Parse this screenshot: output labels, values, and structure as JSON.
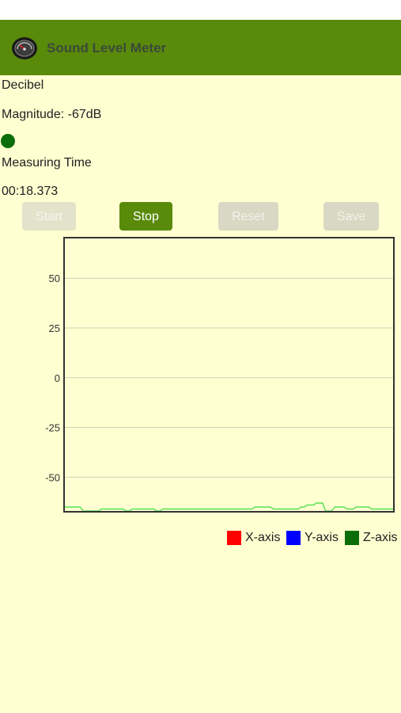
{
  "app": {
    "title": "Sound Level Meter",
    "icon": "speedometer-icon"
  },
  "labels": {
    "decibel": "Decibel",
    "magnitude": "Magnitude: -67dB",
    "measuring_time_label": "Measuring Time",
    "measuring_time_value": "00:18.373"
  },
  "buttons": {
    "start": "Start",
    "stop": "Stop",
    "reset": "Reset",
    "save": "Save"
  },
  "colors": {
    "header": "#5a8a0a",
    "background": "#ffffd1",
    "indicator": "#0b6e0b",
    "x_axis": "#ff0000",
    "y_axis": "#0000ff",
    "z_axis": "#0b6e0b",
    "z_line": "#55e055"
  },
  "chart_data": {
    "type": "line",
    "ylim": [
      -67,
      70
    ],
    "yticks": [
      50,
      25,
      0,
      -25,
      -50
    ],
    "ytick_labels": [
      "50",
      "25",
      "0",
      "-25",
      "-50"
    ],
    "grid": true,
    "legend_position": "bottom-right",
    "legend": [
      "X-axis",
      "Y-axis",
      "Z-axis"
    ],
    "series": [
      {
        "name": "Z-axis",
        "values": [
          -65,
          -65,
          -65,
          -65,
          -65,
          -65,
          -67,
          -67,
          -67,
          -67,
          -67,
          -67,
          -66,
          -66,
          -66,
          -66,
          -66,
          -66,
          -66,
          -66,
          -67,
          -67,
          -66,
          -66,
          -66,
          -66,
          -66,
          -66,
          -66,
          -66,
          -67,
          -67,
          -66,
          -66,
          -66,
          -66,
          -66,
          -66,
          -66,
          -66,
          -66,
          -66,
          -66,
          -66,
          -66,
          -66,
          -66,
          -66,
          -66,
          -66,
          -66,
          -66,
          -66,
          -66,
          -66,
          -66,
          -66,
          -66,
          -66,
          -66,
          -66,
          -66,
          -65,
          -65,
          -65,
          -65,
          -65,
          -65,
          -66,
          -66,
          -66,
          -66,
          -66,
          -66,
          -66,
          -66,
          -66,
          -65,
          -65,
          -64,
          -64,
          -64,
          -63,
          -63,
          -63,
          -67,
          -67,
          -67,
          -65,
          -65,
          -65,
          -65,
          -66,
          -66,
          -66,
          -65,
          -65,
          -65,
          -65,
          -65,
          -66,
          -66,
          -66,
          -66,
          -66,
          -66,
          -66,
          -66
        ]
      }
    ]
  }
}
